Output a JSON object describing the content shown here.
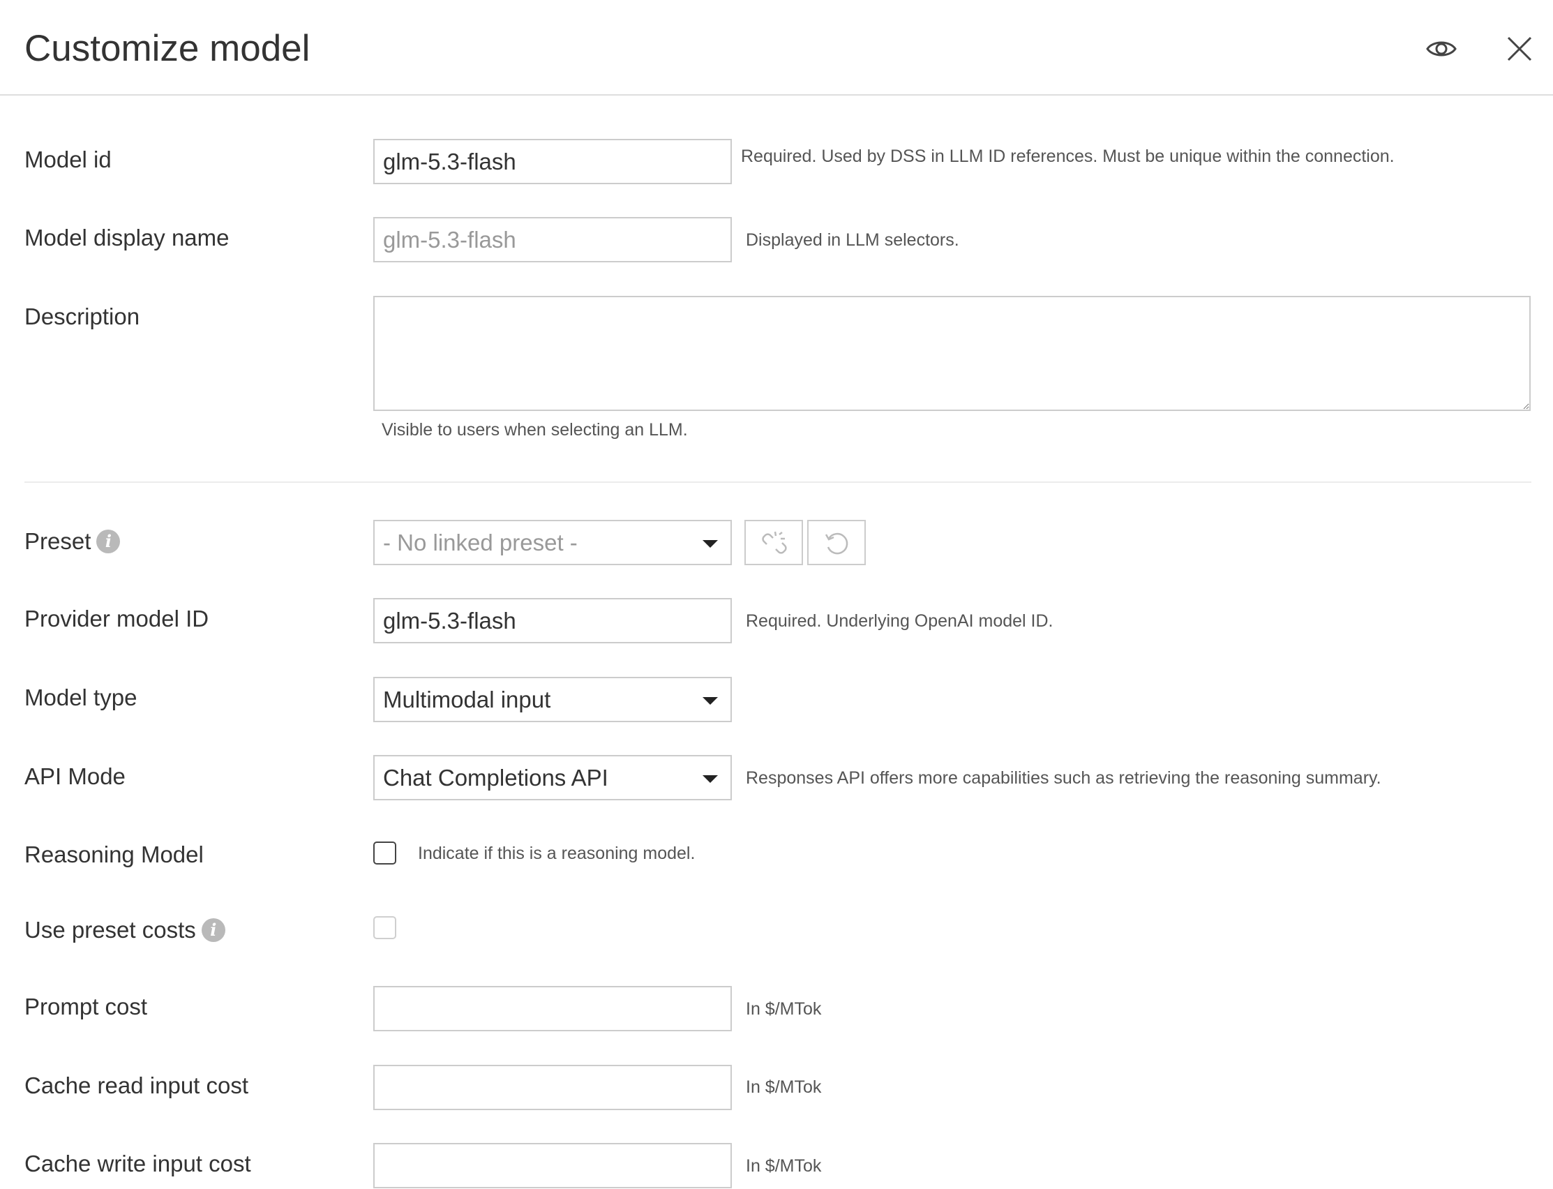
{
  "header": {
    "title": "Customize model",
    "icons": {
      "preview": "eye-icon",
      "close": "close-icon"
    }
  },
  "form": {
    "model_id": {
      "label": "Model id",
      "value": "glm-5.3-flash",
      "hint": "Required. Used by DSS in LLM ID references. Must be unique within the connection."
    },
    "display_name": {
      "label": "Model display name",
      "placeholder": "glm-5.3-flash",
      "hint": "Displayed in LLM selectors."
    },
    "description": {
      "label": "Description",
      "value": "",
      "hint": "Visible to users when selecting an LLM."
    },
    "preset": {
      "label": "Preset",
      "selected": "- No linked preset -",
      "icons": {
        "info": "info-icon",
        "unlink": "unlink-icon",
        "reset": "reset-icon"
      }
    },
    "provider_model_id": {
      "label": "Provider model ID",
      "value": "glm-5.3-flash",
      "hint": "Required. Underlying OpenAI model ID."
    },
    "model_type": {
      "label": "Model type",
      "selected": "Multimodal input"
    },
    "api_mode": {
      "label": "API Mode",
      "selected": "Chat Completions API",
      "hint": "Responses API offers more capabilities such as retrieving the reasoning summary."
    },
    "reasoning_model": {
      "label": "Reasoning Model",
      "checked": false,
      "hint": "Indicate if this is a reasoning model."
    },
    "use_preset_costs": {
      "label": "Use preset costs",
      "checked": false,
      "disabled": true
    },
    "prompt_cost": {
      "label": "Prompt cost",
      "value": "",
      "hint": "In $/MTok"
    },
    "cache_read_input_cost": {
      "label": "Cache read input cost",
      "value": "",
      "hint": "In $/MTok"
    },
    "cache_write_input_cost": {
      "label": "Cache write input cost",
      "value": "",
      "hint": "In $/MTok"
    }
  },
  "colors": {
    "border": "#cccccc",
    "text": "#333333",
    "hint": "#555555",
    "placeholder": "#999999",
    "info_badge": "#b9b9b9"
  }
}
